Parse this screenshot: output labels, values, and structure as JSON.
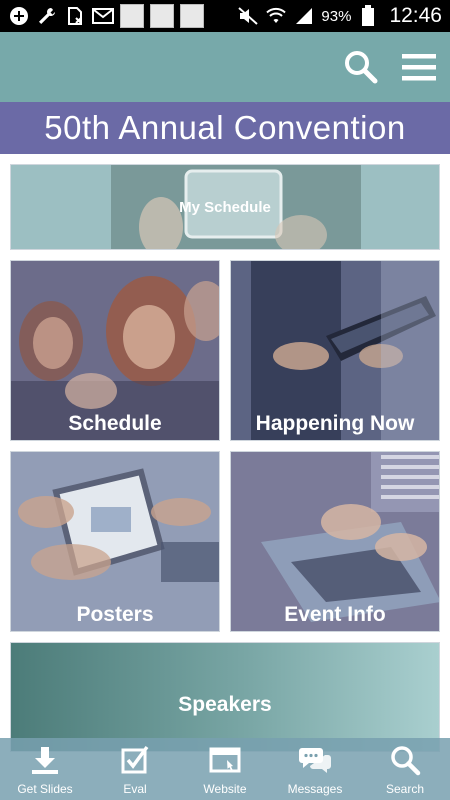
{
  "status_bar": {
    "battery_percent": "93%",
    "time": "12:46",
    "left_icons": [
      "plus-icon",
      "wrench-icon",
      "sim-blocked-icon",
      "gmail-icon",
      "app-notification-1",
      "app-notification-2",
      "app-notification-3"
    ],
    "right_icons": [
      "mute-icon",
      "wifi-icon",
      "signal-icon",
      "battery-icon"
    ]
  },
  "header": {
    "background": "#77a9aa",
    "search_icon": "search-icon",
    "menu_icon": "hamburger-menu-icon"
  },
  "banner": {
    "title": "50th Annual Convention",
    "background": "#6b6aa6"
  },
  "tiles": {
    "my_schedule": {
      "label": "My Schedule"
    },
    "schedule": {
      "label": "Schedule"
    },
    "happening_now": {
      "label": "Happening Now"
    },
    "posters": {
      "label": "Posters"
    },
    "event_info": {
      "label": "Event Info"
    },
    "speakers": {
      "label": "Speakers"
    }
  },
  "bottom_nav": {
    "items": [
      {
        "label": "Get Slides",
        "icon": "download-icon"
      },
      {
        "label": "Eval",
        "icon": "checkbox-icon"
      },
      {
        "label": "Website",
        "icon": "browser-window-icon"
      },
      {
        "label": "Messages",
        "icon": "chat-bubbles-icon"
      },
      {
        "label": "Search",
        "icon": "search-icon"
      }
    ]
  }
}
